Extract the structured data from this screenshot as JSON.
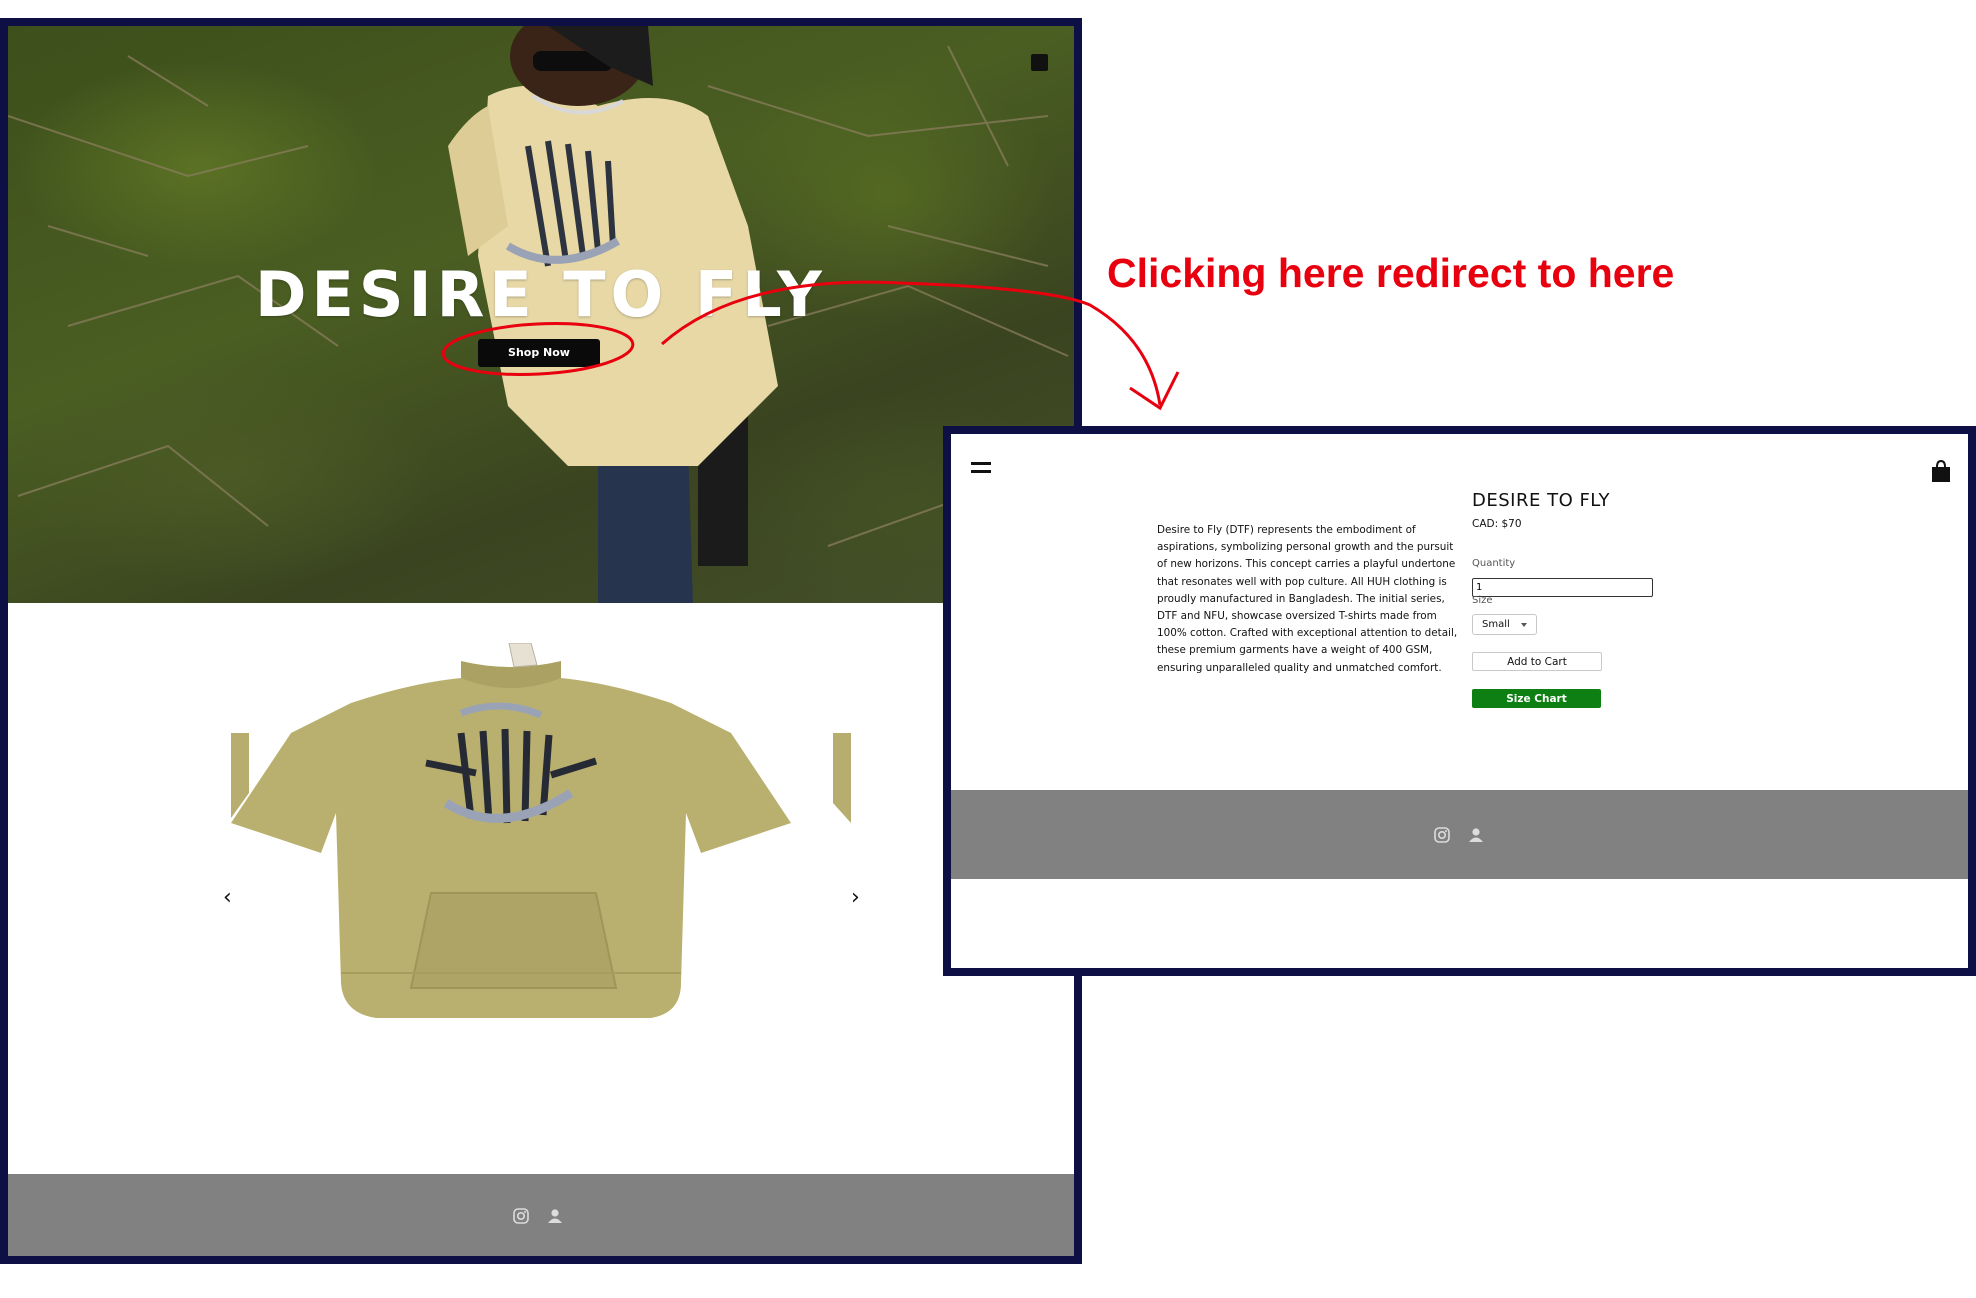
{
  "home": {
    "hero_title": "DESIRE TO FLY",
    "shop_now_label": "Shop Now"
  },
  "annotation": {
    "text": "Clicking here redirect to here",
    "color": "#e8000f"
  },
  "product_page": {
    "title": "DESIRE TO FLY",
    "price": "CAD: $70",
    "description": "Desire to Fly (DTF) represents the embodiment of aspirations, symbolizing personal growth and the pursuit of new horizons. This concept carries a playful undertone that resonates well with pop culture. All HUH clothing is proudly manufactured in Bangladesh. The initial series, DTF and NFU, showcase oversized T-shirts made from 100% cotton. Crafted with exceptional attention to detail, these premium garments have a weight of 400 GSM, ensuring unparalleled quality and unmatched comfort.",
    "quantity_label": "Quantity",
    "quantity_value": "1",
    "size_label": "Size",
    "size_selected": "Small",
    "add_to_cart_label": "Add to Cart",
    "size_chart_label": "Size Chart",
    "size_chart_color": "#0e7f12"
  },
  "icons": {
    "menu": "menu-icon",
    "cart": "shopping-bag-icon",
    "instagram": "instagram-icon",
    "account": "user-icon",
    "prev": "chevron-left-icon",
    "next": "chevron-right-icon"
  },
  "colors": {
    "frame_border": "#0e0f45",
    "footer_bg": "#818181"
  }
}
